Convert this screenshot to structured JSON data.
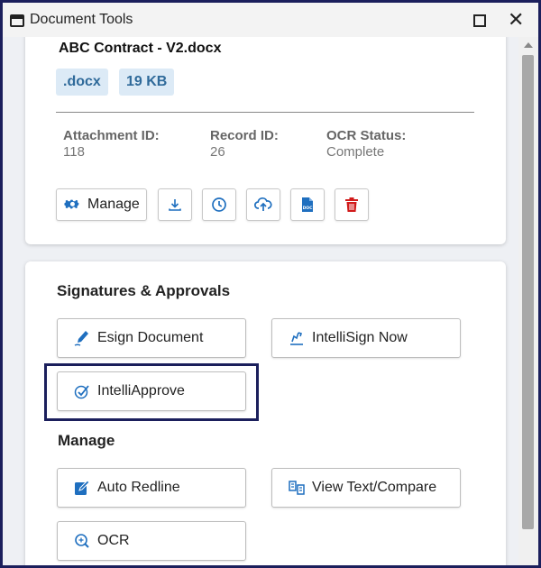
{
  "window": {
    "title": "Document Tools"
  },
  "document": {
    "name": "ABC Contract - V2.docx",
    "extension": ".docx",
    "size": "19 KB",
    "attachment_id_label": "Attachment ID:",
    "attachment_id": "118",
    "record_id_label": "Record ID:",
    "record_id": "26",
    "ocr_status_label": "OCR Status:",
    "ocr_status": "Complete"
  },
  "toolbar": {
    "manage_label": "Manage",
    "icons": [
      "download-icon",
      "history-icon",
      "upload-icon",
      "doc-file-icon",
      "trash-icon"
    ]
  },
  "signatures": {
    "title": "Signatures & Approvals",
    "esign_label": "Esign Document",
    "intellisign_label": "IntelliSign Now",
    "intelliapprove_label": "IntelliApprove"
  },
  "manage": {
    "title": "Manage",
    "auto_redline_label": "Auto Redline",
    "view_compare_label": "View Text/Compare",
    "ocr_label": "OCR"
  },
  "colors": {
    "accent": "#1f6fbf",
    "danger": "#d11a1a",
    "tag_bg": "#dceaf6",
    "tag_text": "#2f6a9a",
    "highlight": "#1b1f5c"
  }
}
